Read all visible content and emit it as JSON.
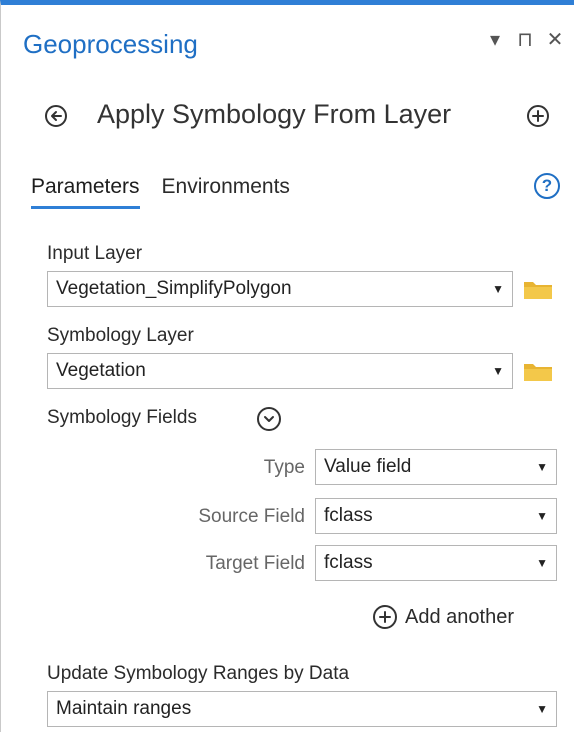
{
  "panel": {
    "title": "Geoprocessing",
    "controls": {
      "options_icon": "chevron-down-icon",
      "pin_icon": "pin-icon",
      "close_icon": "close-icon",
      "options_glyph": "▾",
      "pin_glyph": "⊓",
      "close_glyph": "✕"
    }
  },
  "tool": {
    "back_icon": "back-arrow-icon",
    "title": "Apply Symbology From Layer",
    "add_icon": "plus-icon"
  },
  "tabs": [
    {
      "label": "Parameters",
      "active": true
    },
    {
      "label": "Environments",
      "active": false
    }
  ],
  "help_icon_glyph": "?",
  "parameters": {
    "input_layer": {
      "label": "Input Layer",
      "value": "Vegetation_SimplifyPolygon"
    },
    "symbology_layer": {
      "label": "Symbology Layer",
      "value": "Vegetation"
    },
    "symbology_fields": {
      "label": "Symbology Fields",
      "type": {
        "label": "Type",
        "value": "Value field"
      },
      "source_field": {
        "label": "Source Field",
        "value": "fclass"
      },
      "target_field": {
        "label": "Target Field",
        "value": "fclass"
      },
      "add_another_label": "Add another"
    },
    "update_ranges": {
      "label": "Update Symbology Ranges by Data",
      "value": "Maintain ranges"
    }
  },
  "colors": {
    "accent": "#2f7fd6",
    "title_blue": "#1f6fc4",
    "folder_yellow": "#e8b432"
  }
}
